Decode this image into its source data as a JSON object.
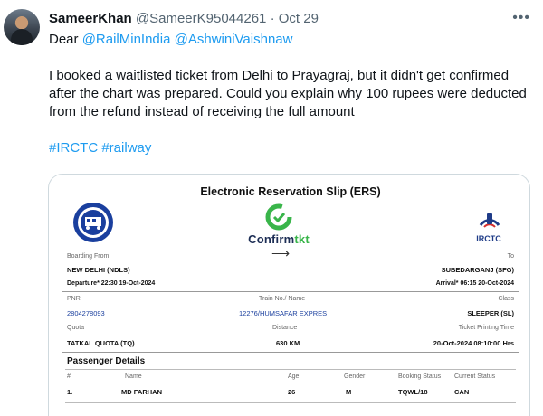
{
  "tweet": {
    "name": "SameerKhan",
    "handle": "@SameerK95044261",
    "separator": "·",
    "date": "Oct 29",
    "more_icon": "more-horizontal-icon",
    "greeting": "Dear",
    "mention_1": "@RailMinIndia",
    "mention_2": "@AshwiniVaishnaw",
    "text": "I booked a waitlisted ticket from Delhi to Prayagraj, but it didn't get confirmed after the chart was prepared. Could you explain why 100 rupees were deducted from the refund instead of receiving the full amount",
    "hashtag_1": "#IRCTC",
    "hashtag_2": "#railway"
  },
  "ers": {
    "title": "Electronic Reservation Slip (ERS)",
    "confirmtkt_brand_a": "Confirm",
    "confirmtkt_brand_b": "tkt",
    "confirmtkt_arrow": "⟶",
    "irctc_label": "IRCTC",
    "boarding_from_label": "Boarding From",
    "to_label": "To",
    "from_station": "NEW DELHI (NDLS)",
    "to_station": "SUBEDARGANJ (SFG)",
    "departure": "Departure* 22:30 19-Oct-2024",
    "arrival": "Arrival* 06:15 20-Oct-2024",
    "pnr_label": "PNR",
    "train_label": "Train No./ Name",
    "class_label": "Class",
    "pnr": "2804278093",
    "train": "12276/HUMSAFAR EXPRES",
    "class": "SLEEPER (SL)",
    "quota_label": "Quota",
    "distance_label": "Distance",
    "printing_label": "Ticket Printing Time",
    "quota": "TATKAL QUOTA (TQ)",
    "distance": "630 KM",
    "printing_time": "20-Oct-2024 08:10:00 Hrs",
    "passenger_details": "Passenger Details",
    "columns": {
      "num": "#",
      "name": "Name",
      "age": "Age",
      "gender": "Gender",
      "booking_status": "Booking Status",
      "current_status": "Current Status"
    },
    "passengers": [
      {
        "num": "1.",
        "name": "MD FARHAN",
        "age": "26",
        "gender": "M",
        "booking_status": "TQWL/18",
        "current_status": "CAN"
      }
    ]
  }
}
